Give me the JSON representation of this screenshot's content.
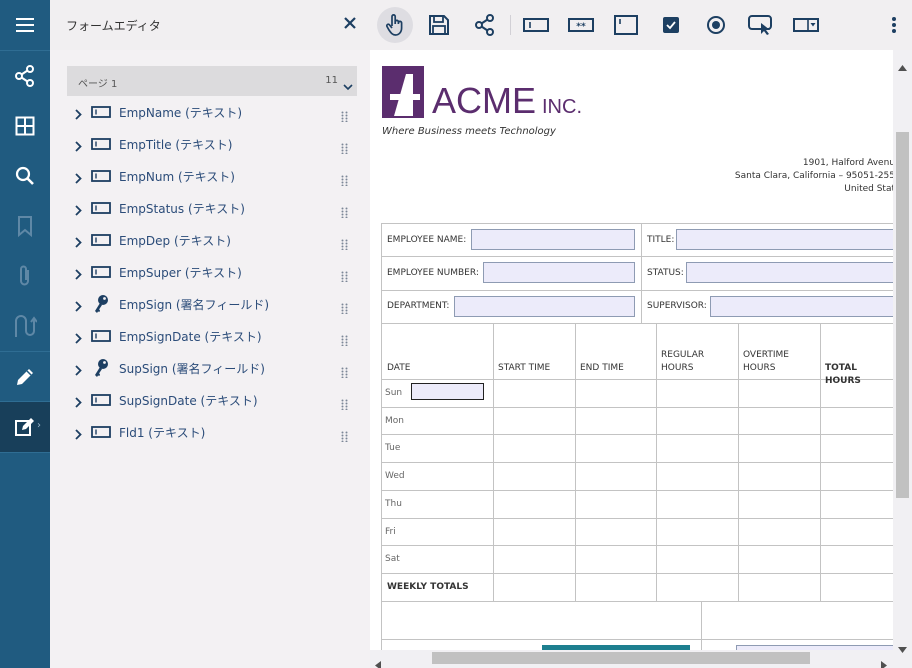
{
  "panel": {
    "title": "フォームエディタ",
    "page_label": "ページ 1",
    "page_count": "11",
    "fields": [
      {
        "label": "EmpName (テキスト)",
        "icon": "text-field-icon"
      },
      {
        "label": "EmpTitle (テキスト)",
        "icon": "text-field-icon"
      },
      {
        "label": "EmpNum (テキスト)",
        "icon": "text-field-icon"
      },
      {
        "label": "EmpStatus (テキスト)",
        "icon": "text-field-icon"
      },
      {
        "label": "EmpDep (テキスト)",
        "icon": "text-field-icon"
      },
      {
        "label": "EmpSuper (テキスト)",
        "icon": "text-field-icon"
      },
      {
        "label": "EmpSign (署名フィールド)",
        "icon": "signature-key-icon"
      },
      {
        "label": "EmpSignDate (テキスト)",
        "icon": "text-field-icon"
      },
      {
        "label": "SupSign (署名フィールド)",
        "icon": "signature-key-icon"
      },
      {
        "label": "SupSignDate (テキスト)",
        "icon": "text-field-icon"
      },
      {
        "label": "Fld1 (テキスト)",
        "icon": "text-field-icon"
      }
    ]
  },
  "toolbar": {
    "tools": [
      "pointer-hand-icon",
      "save-icon",
      "share-icon",
      "text-field-tool-icon",
      "password-field-tool-icon",
      "textarea-tool-icon",
      "checkbox-tool-icon",
      "radio-button-tool-icon",
      "push-button-tool-icon",
      "combobox-tool-icon",
      "more-vertical-icon"
    ]
  },
  "rail": {
    "items": [
      "menu-icon",
      "share-icon",
      "thumbnails-icon",
      "search-icon",
      "bookmark-icon",
      "attachment-icon",
      "signature-icon",
      "annotation-edit-icon",
      "form-editor-icon"
    ]
  },
  "document": {
    "logo_text": "ACME",
    "logo_suffix": "INC.",
    "tagline": "Where Business meets Technology",
    "address": [
      "1901, Halford Avenu",
      "Santa Clara, California – 95051-255",
      "United Stat"
    ],
    "labels": {
      "employee_name": "EMPLOYEE NAME:",
      "title": "TITLE:",
      "employee_number": "EMPLOYEE NUMBER:",
      "status": "STATUS:",
      "department": "DEPARTMENT:",
      "supervisor": "SUPERVISOR:"
    },
    "table_headers": {
      "date": "DATE",
      "start_time": "START TIME",
      "end_time": "END TIME",
      "regular_1": "REGULAR",
      "regular_2": "HOURS",
      "overtime_1": "OVERTIME",
      "overtime_2": "HOURS",
      "total_hours": "TOTAL HOURS"
    },
    "days": [
      "Sun",
      "Mon",
      "Tue",
      "Wed",
      "Thu",
      "Fri",
      "Sat"
    ],
    "weekly_totals": "WEEKLY TOTALS"
  },
  "colors": {
    "rail": "#205b80",
    "rail_active": "#183f5a",
    "logo": "#5b2d6e",
    "field_fill": "#ecebfa",
    "label_text": "#2b4c79"
  }
}
